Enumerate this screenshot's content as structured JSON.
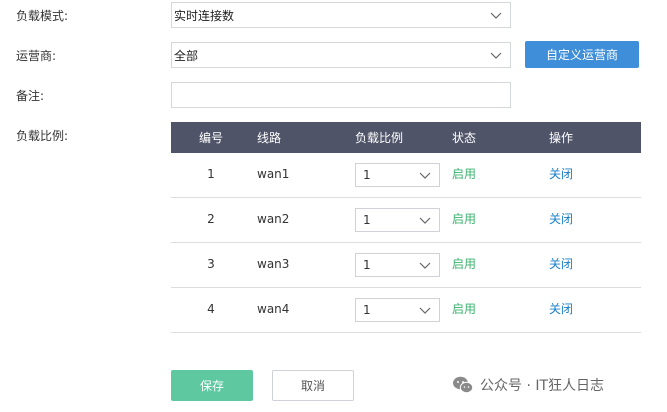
{
  "form": {
    "load_mode_label": "负载模式:",
    "load_mode_value": "实时连接数",
    "isp_label": "运营商:",
    "isp_value": "全部",
    "custom_isp_button": "自定义运营商",
    "remark_label": "备注:",
    "remark_value": "",
    "ratio_label": "负载比例:"
  },
  "table": {
    "headers": [
      "编号",
      "线路",
      "负载比例",
      "状态",
      "操作"
    ],
    "rows": [
      {
        "no": "1",
        "line": "wan1",
        "ratio": "1",
        "status": "启用",
        "action": "关闭"
      },
      {
        "no": "2",
        "line": "wan2",
        "ratio": "1",
        "status": "启用",
        "action": "关闭"
      },
      {
        "no": "3",
        "line": "wan3",
        "ratio": "1",
        "status": "启用",
        "action": "关闭"
      },
      {
        "no": "4",
        "line": "wan4",
        "ratio": "1",
        "status": "启用",
        "action": "关闭"
      }
    ]
  },
  "buttons": {
    "save": "保存",
    "cancel": "取消"
  },
  "watermark": {
    "text": "公众号 · IT狂人日志"
  },
  "colors": {
    "header_bg": "#4f5468",
    "primary_blue": "#3e8ed9",
    "save_green": "#5ec8a0",
    "status_green": "#3cb371",
    "link_blue": "#1a7fc8"
  },
  "icons": {
    "dropdown": "chevron-down-icon",
    "watermark": "wechat-icon"
  }
}
